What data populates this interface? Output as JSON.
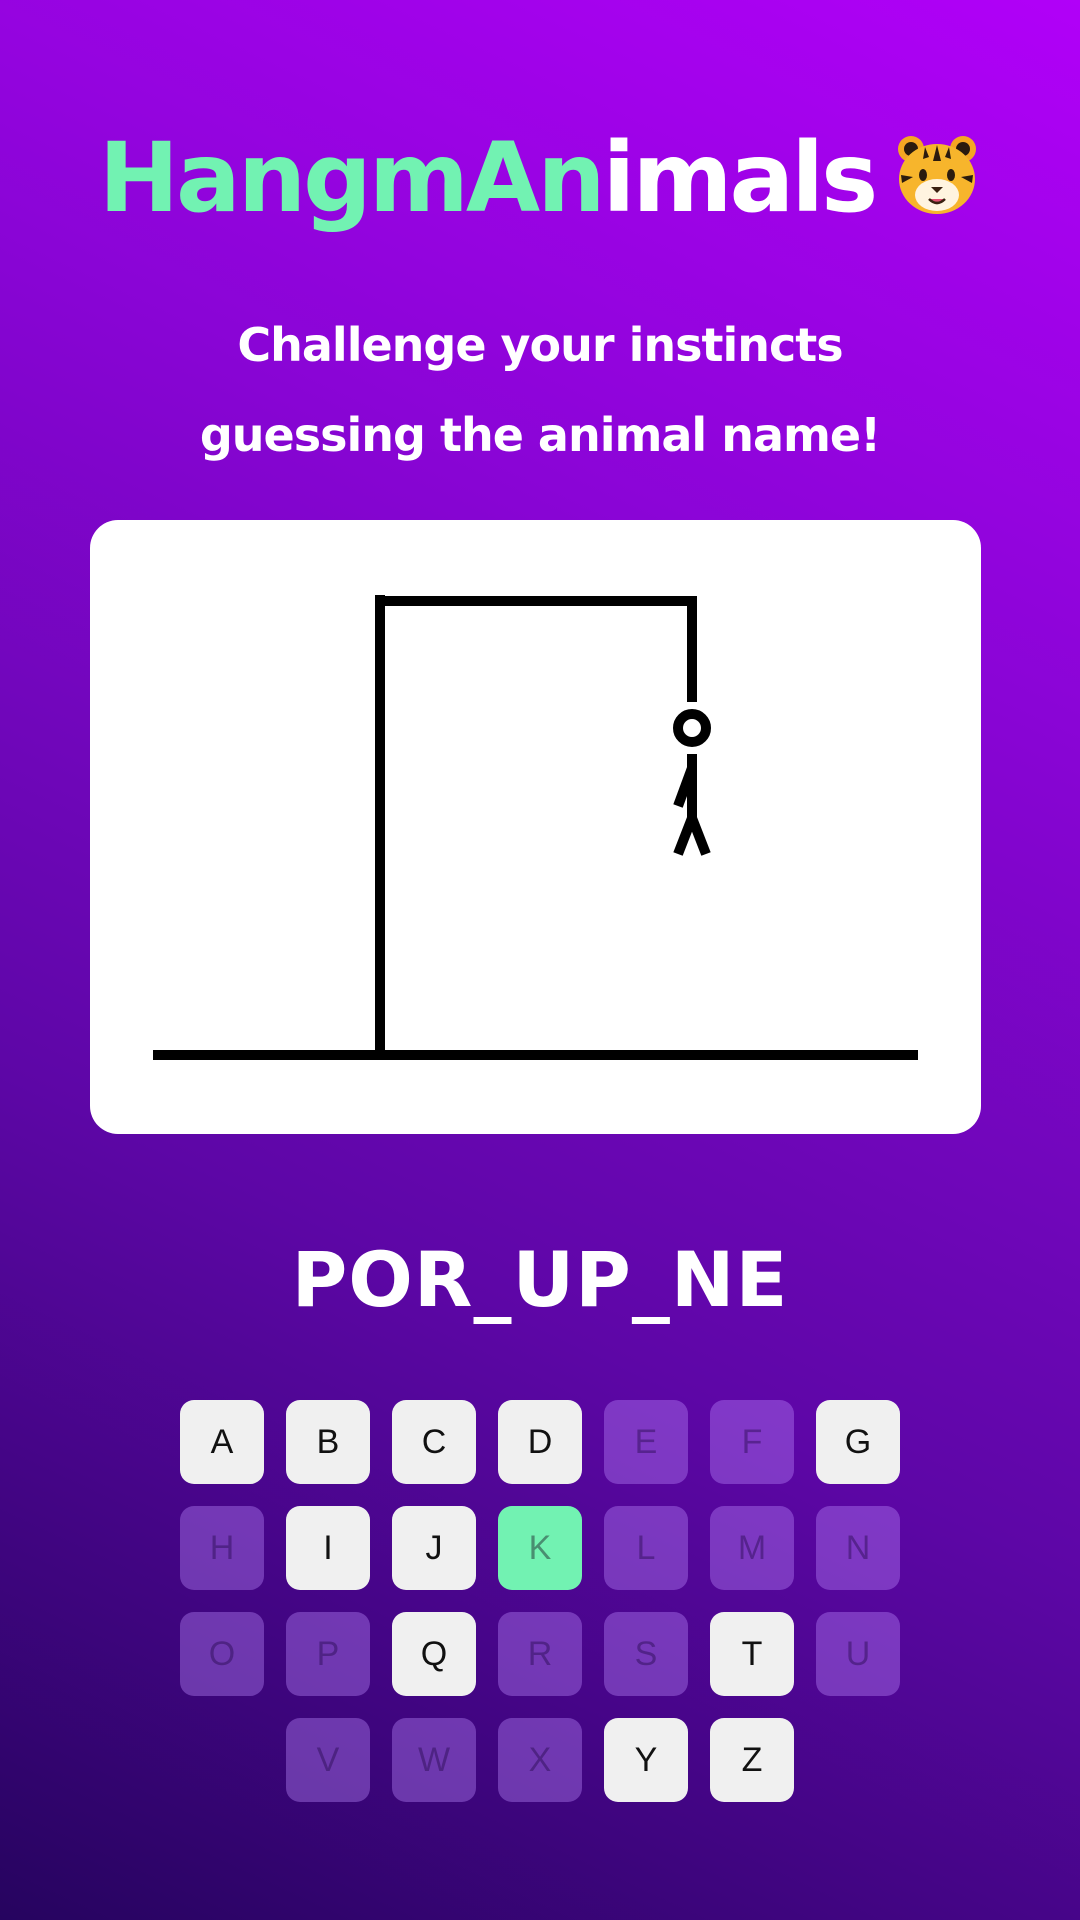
{
  "app": {
    "title_part1": "HangmAn",
    "title_part2": "imals",
    "title_icon": "tiger-face-icon",
    "subtitle": "Challenge your instincts guessing the animal name!"
  },
  "game": {
    "masked_word": "POR_UP_NE",
    "hangman_parts_shown": [
      "head",
      "body",
      "left-arm",
      "left-leg",
      "right-leg"
    ]
  },
  "keyboard": {
    "rows": [
      [
        {
          "letter": "A",
          "state": "available"
        },
        {
          "letter": "B",
          "state": "available"
        },
        {
          "letter": "C",
          "state": "available"
        },
        {
          "letter": "D",
          "state": "available"
        },
        {
          "letter": "E",
          "state": "used"
        },
        {
          "letter": "F",
          "state": "used"
        },
        {
          "letter": "G",
          "state": "available"
        }
      ],
      [
        {
          "letter": "H",
          "state": "used"
        },
        {
          "letter": "I",
          "state": "available"
        },
        {
          "letter": "J",
          "state": "available"
        },
        {
          "letter": "K",
          "state": "correct"
        },
        {
          "letter": "L",
          "state": "used"
        },
        {
          "letter": "M",
          "state": "used"
        },
        {
          "letter": "N",
          "state": "used"
        }
      ],
      [
        {
          "letter": "O",
          "state": "used"
        },
        {
          "letter": "P",
          "state": "used"
        },
        {
          "letter": "Q",
          "state": "available"
        },
        {
          "letter": "R",
          "state": "used"
        },
        {
          "letter": "S",
          "state": "used"
        },
        {
          "letter": "T",
          "state": "available"
        },
        {
          "letter": "U",
          "state": "used"
        }
      ],
      [
        {
          "letter": "V",
          "state": "used"
        },
        {
          "letter": "W",
          "state": "used"
        },
        {
          "letter": "X",
          "state": "used"
        },
        {
          "letter": "Y",
          "state": "available"
        },
        {
          "letter": "Z",
          "state": "available"
        }
      ]
    ]
  },
  "colors": {
    "accent": "#72f2b2",
    "key_available": "#f0f0f0",
    "key_used": "#8b4fc4",
    "bg_top": "#b100f8",
    "bg_bottom": "#26045f"
  }
}
